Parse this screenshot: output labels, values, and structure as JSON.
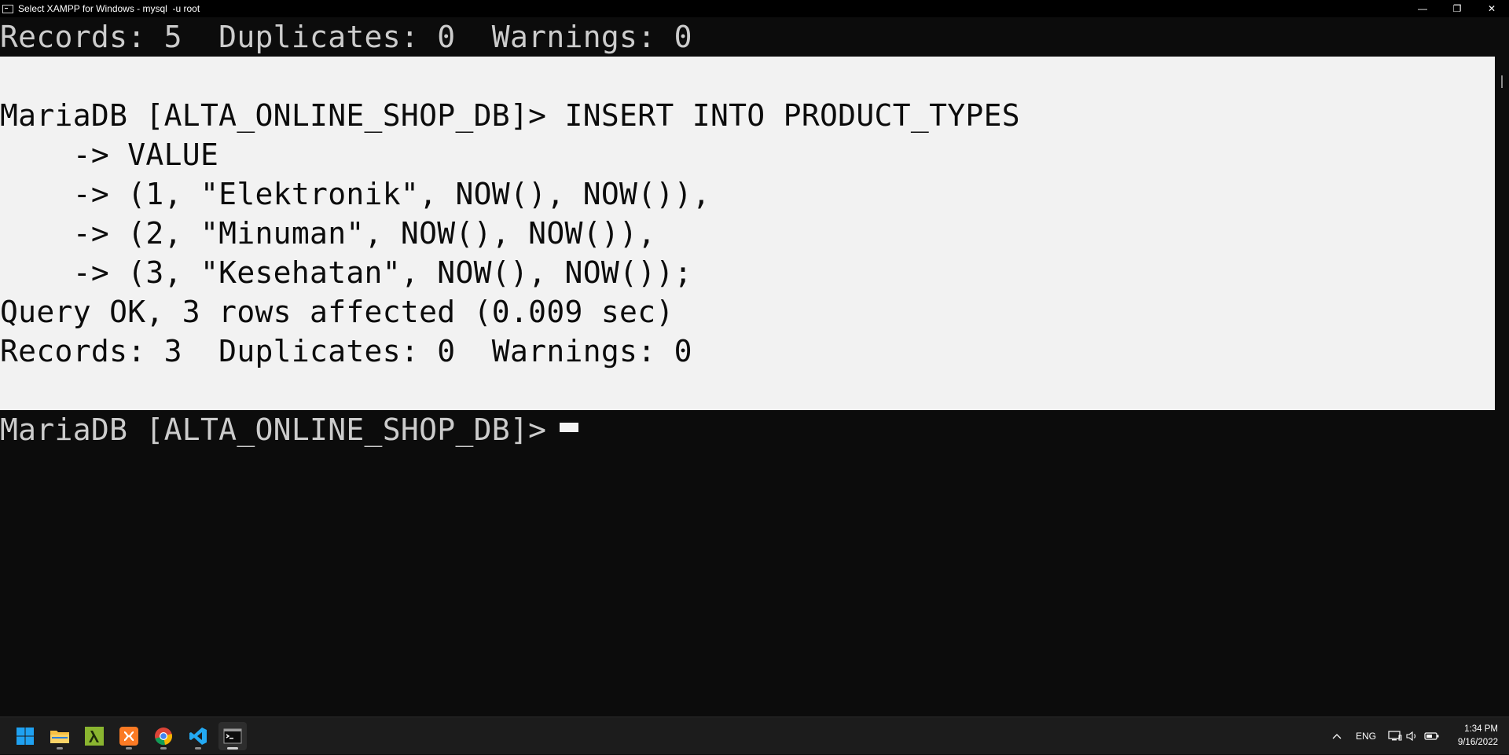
{
  "window": {
    "title": "Select XAMPP for Windows - mysql  -u root",
    "controls": {
      "minimize": "—",
      "restore": "❐",
      "close": "✕"
    }
  },
  "console": {
    "lines": [
      "Records: 5  Duplicates: 0  Warnings: 0",
      "",
      "MariaDB [ALTA_ONLINE_SHOP_DB]> INSERT INTO PRODUCT_TYPES",
      "    -> VALUE",
      "    -> (1, \"Elektronik\", NOW(), NOW()),",
      "    -> (2, \"Minuman\", NOW(), NOW()),",
      "    -> (3, \"Kesehatan\", NOW(), NOW());",
      "Query OK, 3 rows affected (0.009 sec)",
      "Records: 3  Duplicates: 0  Warnings: 0",
      "",
      "MariaDB [ALTA_ONLINE_SHOP_DB]> "
    ],
    "selected_lines": "1-9"
  },
  "taskbar": {
    "apps": [
      {
        "name": "start",
        "icon": "windows-logo-icon"
      },
      {
        "name": "file-explorer",
        "icon": "folder-icon"
      },
      {
        "name": "cmder",
        "icon": "lambda-icon"
      },
      {
        "name": "xampp",
        "icon": "xampp-icon"
      },
      {
        "name": "chrome",
        "icon": "chrome-icon"
      },
      {
        "name": "vscode",
        "icon": "vscode-icon"
      },
      {
        "name": "terminal",
        "icon": "terminal-icon"
      }
    ],
    "tray": {
      "chevron": "^",
      "language": "ENG",
      "time": "1:34 PM",
      "date": "9/16/2022"
    }
  },
  "colors": {
    "console_bg": "#0c0c0c",
    "console_fg": "#cccccc",
    "selection_bg": "#f2f2f2",
    "selection_fg": "#0c0c0c",
    "taskbar_bg": "#1c1c1c"
  }
}
